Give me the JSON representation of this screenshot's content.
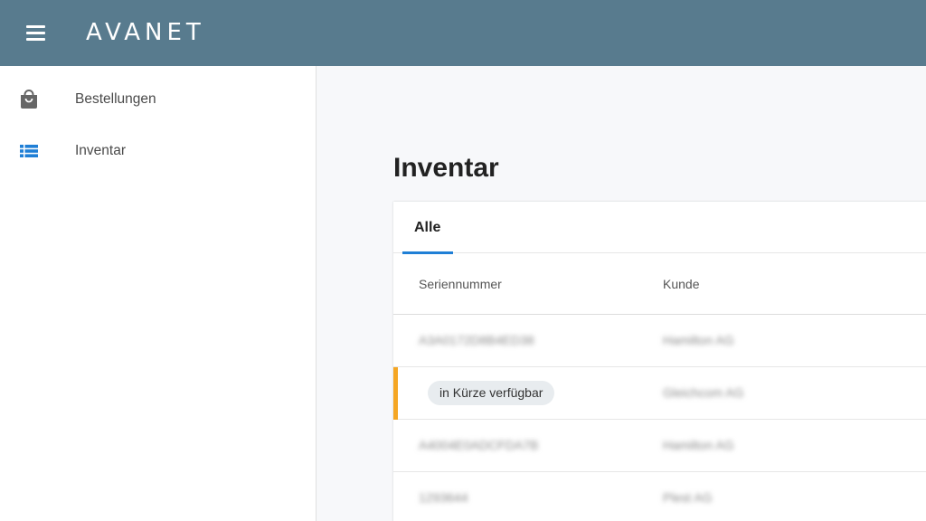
{
  "app": {
    "logo_text": "AVANET",
    "accent_color": "#587b8e",
    "menu_icon": "hamburger-menu-icon"
  },
  "sidebar": {
    "items": [
      {
        "label": "Bestellungen",
        "icon": "shopping-bag-icon",
        "icon_color": "#666666"
      },
      {
        "label": "Inventar",
        "icon": "list-icon",
        "icon_color": "#1f7fd6"
      }
    ]
  },
  "main": {
    "title": "Inventar",
    "tabs": [
      {
        "label": "Alle",
        "active": true
      }
    ],
    "table": {
      "columns": [
        "Seriennummer",
        "Kunde"
      ],
      "rows": [
        {
          "serial": "A3A0172D8B4ED38",
          "customer": "Hamilton AG",
          "status_badge": null,
          "flag_color": null
        },
        {
          "serial": null,
          "customer": "Gleichcom AG",
          "status_badge": "in Kürze verfügbar",
          "flag_color": "#f5a623"
        },
        {
          "serial": "A4004E0ADCFDA7B",
          "customer": "Hamilton AG",
          "status_badge": null,
          "flag_color": null
        },
        {
          "serial": "1293644",
          "customer": "Plest AG",
          "status_badge": null,
          "flag_color": null
        }
      ]
    }
  }
}
